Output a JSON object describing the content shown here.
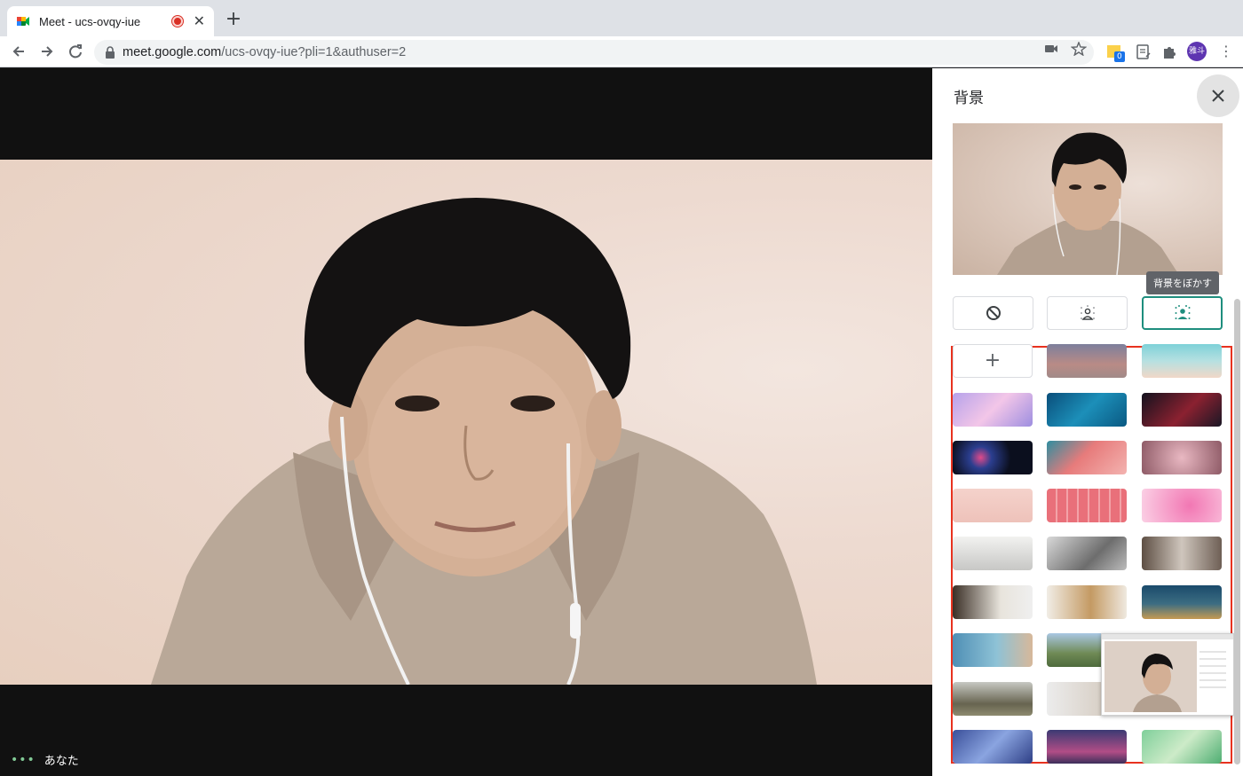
{
  "browser": {
    "tab_title": "Meet - ucs-ovqy-iue",
    "tab_close": "✕",
    "new_tab": "+",
    "url_host": "meet.google.com",
    "url_path": "/ucs-ovqy-iue?pli=1&authuser=2",
    "extension_badge": "0",
    "avatar_text": "雅斗"
  },
  "meet": {
    "self_label": "あなた",
    "menu_dots": "•••"
  },
  "panel": {
    "title": "背景",
    "tooltip": "背景をぼかす",
    "add_label": "+"
  },
  "colors": {
    "accent": "#1e8e7e",
    "highlight_outline": "#e8321f",
    "recording": "#d93025"
  }
}
